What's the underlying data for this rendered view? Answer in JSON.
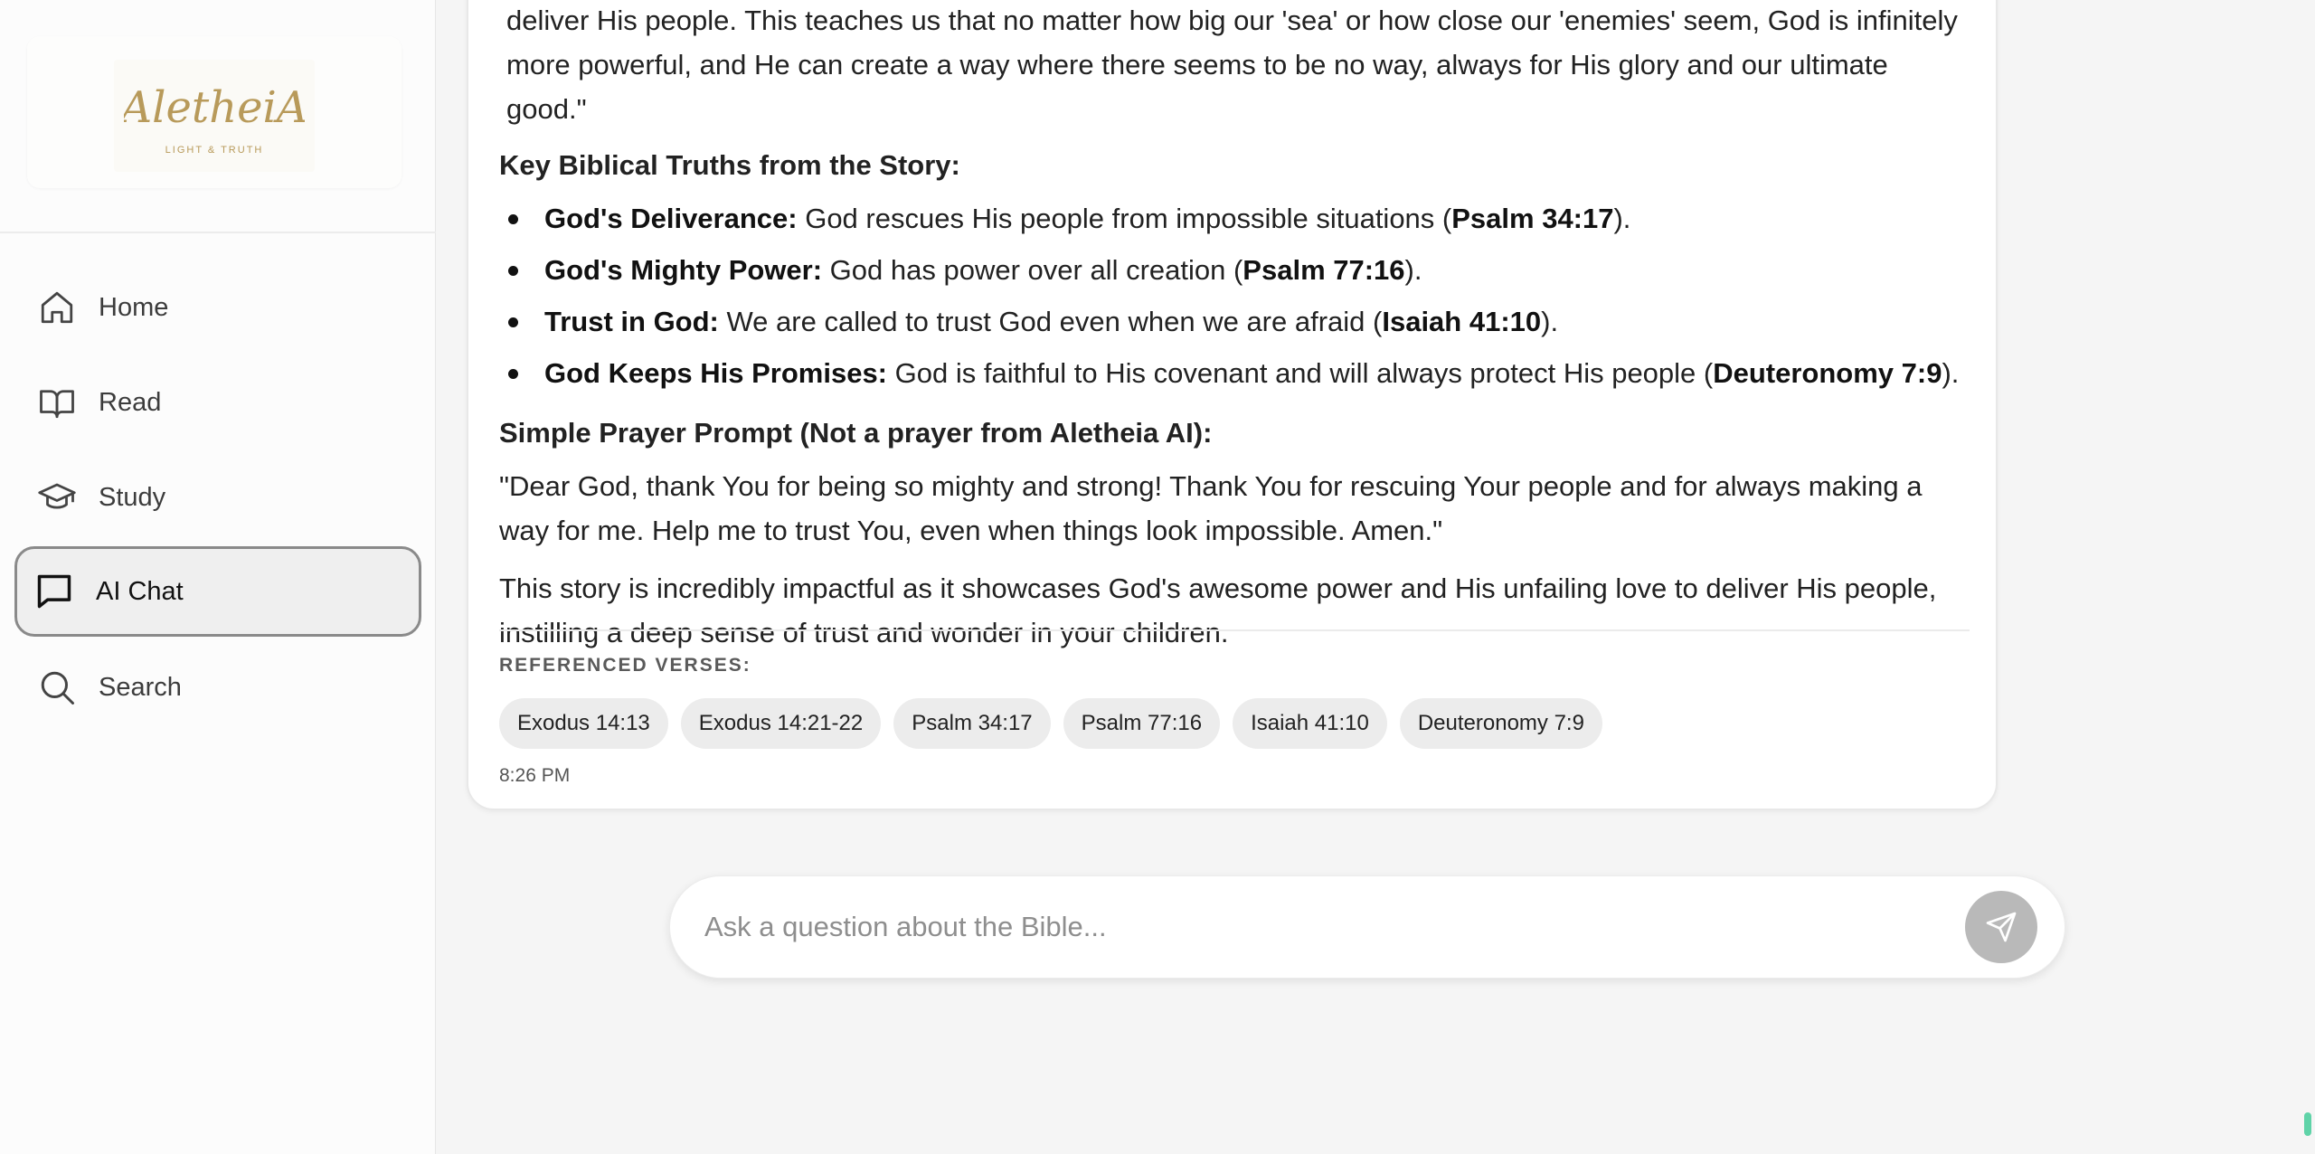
{
  "sidebar": {
    "logo": {
      "text": "AletheiA",
      "tagline": "LIGHT & TRUTH",
      "color": "#b89a5a"
    },
    "items": [
      {
        "label": "Home",
        "icon": "home-icon"
      },
      {
        "label": "Read",
        "icon": "book-icon"
      },
      {
        "label": "Study",
        "icon": "graduation-cap-icon"
      },
      {
        "label": "AI Chat",
        "icon": "chat-bubble-icon",
        "active": true
      },
      {
        "label": "Search",
        "icon": "search-icon"
      }
    ]
  },
  "message": {
    "quote_line1": "deliver His people. This teaches us that no matter how big our 'sea' or how close our 'enemies' seem, God is infinitely",
    "quote_line2": "more powerful, and He can create a way where there seems to be no way, always for His glory and our ultimate good.\"",
    "truths_heading": "Key Biblical Truths from the Story:",
    "truths": [
      {
        "title": "God's Deliverance:",
        "text": " God rescues His people from impossible situations (",
        "ref": "Psalm 34:17",
        "end": ")."
      },
      {
        "title": "God's Mighty Power:",
        "text": " God has power over all creation (",
        "ref": "Psalm 77:16",
        "end": ")."
      },
      {
        "title": "Trust in God:",
        "text": " We are called to trust God even when we are afraid (",
        "ref": "Isaiah 41:10",
        "end": ")."
      },
      {
        "title": "God Keeps His Promises:",
        "text": " God is faithful to His covenant and will always protect His people (",
        "ref": "Deuteronomy 7:9",
        "end": ")."
      }
    ],
    "prayer_heading": "Simple Prayer Prompt (Not a prayer from Aletheia AI):",
    "prayer_text": "\"Dear God, thank You for being so mighty and strong! Thank You for rescuing Your people and for always making a way for me. Help me to trust You, even when things look impossible. Amen.\"",
    "closing_text": "This story is incredibly impactful as it showcases God's awesome power and His unfailing love to deliver His people, instilling a deep sense of trust and wonder in your children.",
    "referenced_heading": "REFERENCED VERSES:",
    "verses": [
      "Exodus 14:13",
      "Exodus 14:21-22",
      "Psalm 34:17",
      "Psalm 77:16",
      "Isaiah 41:10",
      "Deuteronomy 7:9"
    ],
    "timestamp": "8:26 PM"
  },
  "input": {
    "placeholder": "Ask a question about the Bible...",
    "value": "",
    "send_icon": "send-icon"
  },
  "colors": {
    "accent_gold": "#b89a5a",
    "active_border": "#8a8a8a",
    "send_button": "#b9b9b9"
  }
}
